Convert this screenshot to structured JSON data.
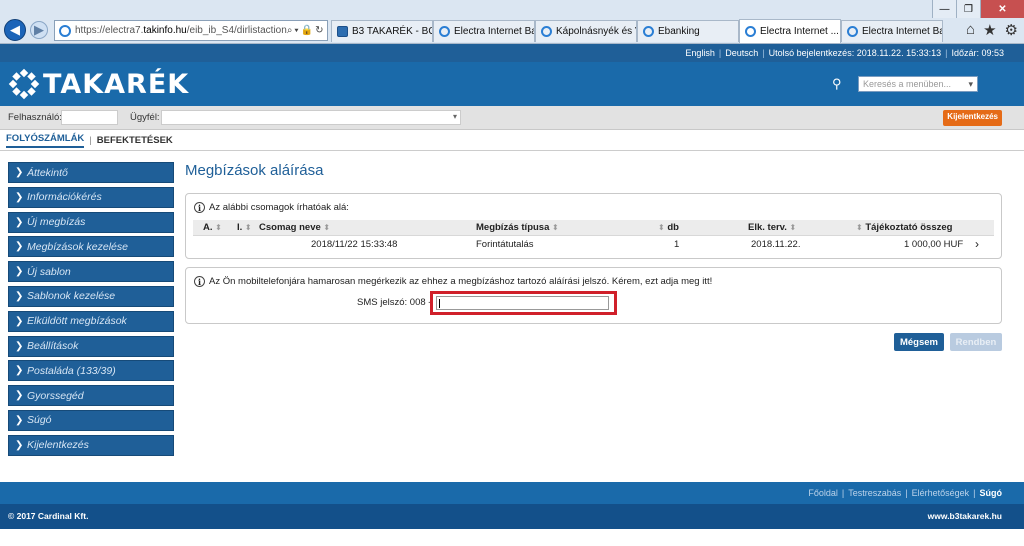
{
  "browser": {
    "address": {
      "prefix": "https://electra7.",
      "host": "takinfo.hu",
      "path": "/eib_ib_S4/dirlistaction",
      "tools": "⌕▾🔒↻"
    },
    "tabs": [
      {
        "label": "B3 TAKARÉK - BO...",
        "icon": "b3-favicon"
      },
      {
        "label": "Electra Internet Ba...",
        "icon": "ie-favicon"
      },
      {
        "label": "Kápolnásnyék és V...",
        "icon": "ie-favicon"
      },
      {
        "label": "Ebanking",
        "icon": "ebanking-favicon"
      },
      {
        "label": "Electra Internet ...",
        "icon": "ie-favicon",
        "active": true
      },
      {
        "label": "Electra Internet Ba...",
        "icon": "ie-favicon"
      }
    ]
  },
  "topbar": {
    "english": "English",
    "deutsch": "Deutsch",
    "last_login": "Utolsó bejelentkezés: 2018.11.22. 15:33:13",
    "timer": "Időzár: 09:53"
  },
  "header": {
    "logo_text": "TAKARÉK",
    "menu_search_placeholder": "Keresés a menüben..."
  },
  "userbar": {
    "user_label": "Felhasználó:",
    "client_label": "Ügyfél:",
    "logout_label": "Kijelentkezés"
  },
  "subnav": {
    "accounts": "FOLYÓSZÁMLÁK",
    "investments": "BEFEKTETÉSEK"
  },
  "sidebar": {
    "items": [
      "Áttekintő",
      "Információkérés",
      "Új megbízás",
      "Megbízások kezelése",
      "Új sablon",
      "Sablonok kezelése",
      "Elküldött megbízások",
      "Beállítások",
      "Postaláda (133/39)",
      "Gyorssegéd",
      "Súgó",
      "Kijelentkezés"
    ]
  },
  "main": {
    "title": "Megbízások aláírása",
    "packages_info": "Az alábbi csomagok írhatóak alá:",
    "columns": {
      "a": "A.",
      "i": "I.",
      "name": "Csomag neve",
      "type": "Megbízás típusa",
      "db": "db",
      "planned": "Elk. terv.",
      "amount": "Tájékoztató összeg"
    },
    "row": {
      "date": "2018/11/22 15:33:48",
      "type": "Forintátutalás",
      "db": "1",
      "planned": "2018.11.22.",
      "amount": "1 000,00 HUF"
    },
    "sms_info": "Az Ön mobiltelefonjára hamarosan megérkezik az ehhez a megbízáshoz tartozó aláírási jelszó. Kérem, ezt adja meg itt!",
    "sms_label": "SMS jelszó: 008 -",
    "cancel_label": "Mégsem",
    "ok_label": "Rendben"
  },
  "footer": {
    "home": "Főoldal",
    "customize": "Testreszabás",
    "contacts": "Elérhetőségek",
    "help": "Súgó",
    "copyright": "© 2017 Cardinal Kft.",
    "site": "www.b3takarek.hu"
  },
  "colors": {
    "brand_blue": "#1a6aaa",
    "dark_blue": "#1f5f98",
    "logout_orange": "#e56b17",
    "highlight_red": "#d0202a"
  }
}
